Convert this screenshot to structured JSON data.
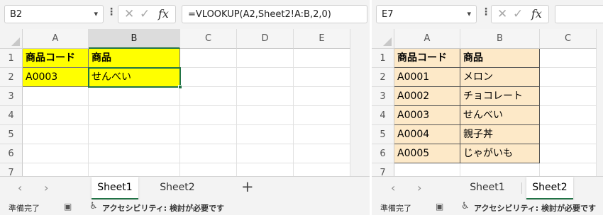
{
  "left": {
    "name_box": "B2",
    "formula": "=VLOOKUP(A2,Sheet2!A:B,2,0)",
    "columns": [
      "A",
      "B",
      "C",
      "D",
      "E"
    ],
    "rows": [
      "1",
      "2",
      "3",
      "4",
      "5",
      "6",
      "7"
    ],
    "cells": [
      [
        "商品コード",
        "商品"
      ],
      [
        "A0003",
        "せんべい"
      ]
    ],
    "tabs": [
      "Sheet1",
      "Sheet2"
    ],
    "active_tab": "Sheet1",
    "add_sheet": "+"
  },
  "right": {
    "name_box": "E7",
    "formula": "",
    "columns": [
      "A",
      "B",
      "C"
    ],
    "rows": [
      "1",
      "2",
      "3",
      "4",
      "5",
      "6",
      "7"
    ],
    "cells": [
      [
        "商品コード",
        "商品"
      ],
      [
        "A0001",
        "メロン"
      ],
      [
        "A0002",
        "チョコレート"
      ],
      [
        "A0003",
        "せんべい"
      ],
      [
        "A0004",
        "親子丼"
      ],
      [
        "A0005",
        "じゃがいも"
      ]
    ],
    "tabs": [
      "Sheet1",
      "Sheet2"
    ],
    "active_tab": "Sheet2"
  },
  "status": {
    "ready": "準備完了",
    "accessibility": "アクセシビリティ: 検討が必要です"
  },
  "icons": {
    "dropdown": "▾",
    "more": "⋮",
    "cancel": "✕",
    "enter": "✓",
    "fx": "fx",
    "prev_sheet": "‹",
    "next_sheet": "›",
    "camera": "▣",
    "accessibility": "♿"
  },
  "colors": {
    "accent": "#217346",
    "header_highlight": "#ffff00",
    "table_fill": "#fde9c8"
  }
}
